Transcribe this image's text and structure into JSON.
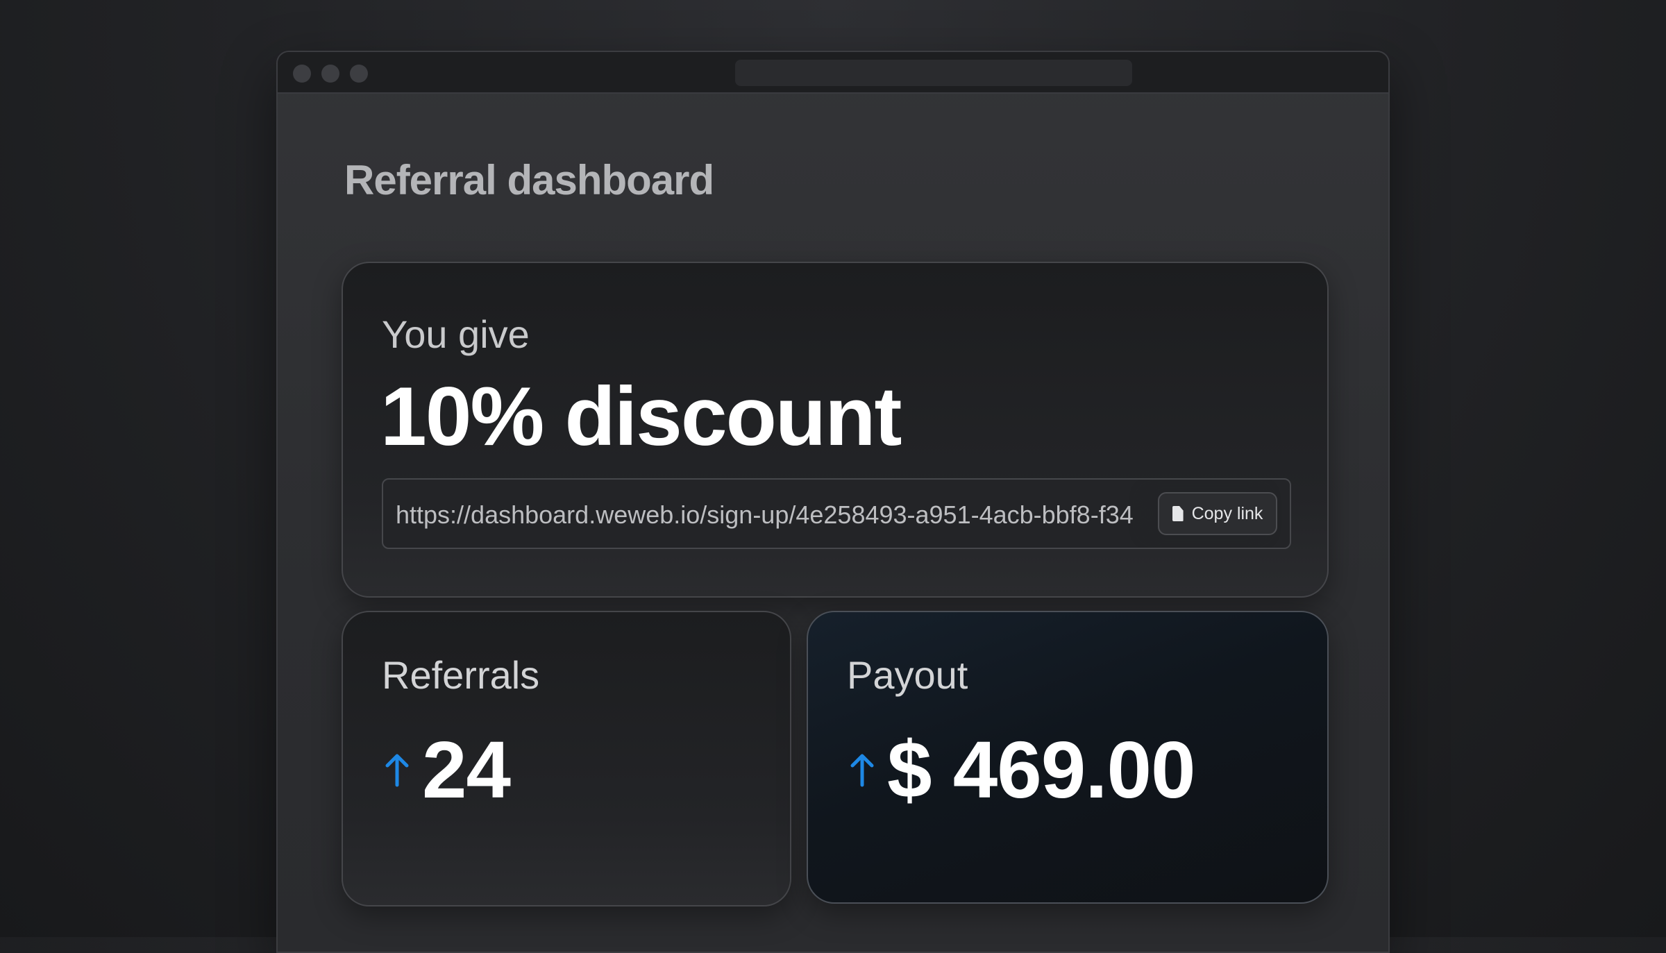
{
  "page": {
    "title": "Referral dashboard"
  },
  "give_card": {
    "label": "You give",
    "value": "10% discount",
    "link": "https://dashboard.weweb.io/sign-up/4e258493-a951-4acb-bbf8-f34",
    "copy_button": "Copy link"
  },
  "referrals": {
    "label": "Referrals",
    "value": "24",
    "trend_icon": "arrow-up-icon"
  },
  "payout": {
    "label": "Payout",
    "value": "$ 469.00",
    "trend_icon": "arrow-up-icon"
  },
  "colors": {
    "accent": "#1e88e5",
    "background": "#232427",
    "card_border": "#45464a"
  }
}
